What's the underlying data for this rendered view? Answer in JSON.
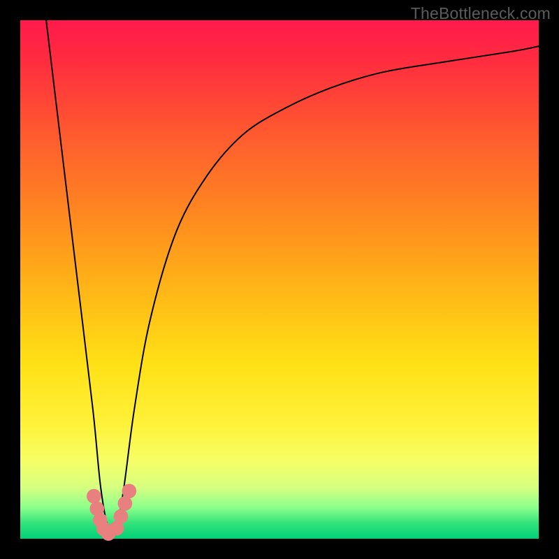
{
  "watermark": "TheBottleneck.com",
  "chart_data": {
    "type": "line",
    "title": "",
    "xlabel": "",
    "ylabel": "",
    "xlim": [
      0,
      100
    ],
    "ylim": [
      0,
      100
    ],
    "grid": false,
    "legend": false,
    "annotations": [],
    "series": [
      {
        "name": "bottleneck-curve",
        "color": "#000000",
        "x": [
          5,
          8,
          11,
          14,
          15.5,
          17,
          18.5,
          20,
          22,
          25,
          30,
          36,
          43,
          51,
          60,
          70,
          82,
          95,
          100
        ],
        "y": [
          100,
          75,
          50,
          25,
          10,
          2,
          2,
          10,
          25,
          42,
          59,
          70,
          78,
          83,
          87,
          90,
          92,
          94,
          95
        ]
      }
    ],
    "marker_clusters": [
      {
        "name": "left-cluster",
        "color": "#e98080",
        "radius_pct": 1.4,
        "points": [
          {
            "x": 14.2,
            "y": 8.2
          },
          {
            "x": 14.8,
            "y": 5.8
          },
          {
            "x": 15.4,
            "y": 3.6
          },
          {
            "x": 16.1,
            "y": 1.9
          },
          {
            "x": 17.0,
            "y": 1.0
          }
        ]
      },
      {
        "name": "right-cluster",
        "color": "#e98080",
        "radius_pct": 1.4,
        "points": [
          {
            "x": 18.6,
            "y": 2.0
          },
          {
            "x": 19.4,
            "y": 4.3
          },
          {
            "x": 20.2,
            "y": 6.8
          },
          {
            "x": 21.0,
            "y": 9.2
          }
        ]
      }
    ]
  }
}
